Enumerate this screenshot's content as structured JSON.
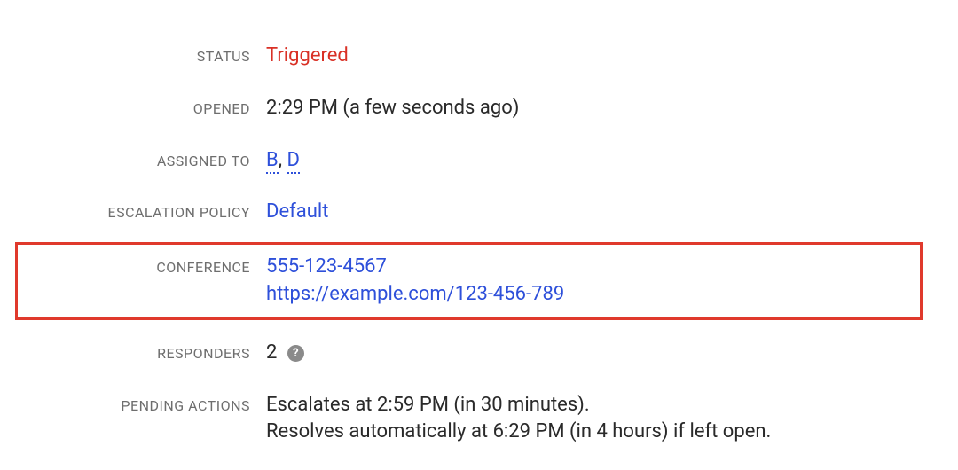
{
  "labels": {
    "status": "Status",
    "opened": "Opened",
    "assigned_to": "Assigned To",
    "escalation_policy": "Escalation Policy",
    "conference": "Conference",
    "responders": "Responders",
    "pending_actions": "Pending Actions"
  },
  "status": {
    "value": "Triggered"
  },
  "opened": {
    "value": "2:29 PM (a few seconds ago)"
  },
  "assigned_to": {
    "items": [
      "B",
      "D"
    ],
    "separator": ", "
  },
  "escalation_policy": {
    "value": "Default"
  },
  "conference": {
    "phone": "555-123-4567",
    "url": "https://example.com/123-456-789"
  },
  "responders": {
    "count": "2",
    "help_glyph": "?"
  },
  "pending_actions": {
    "line1": "Escalates at 2:59 PM (in 30 minutes).",
    "line2": "Resolves automatically at 6:29 PM (in 4 hours) if left open."
  }
}
